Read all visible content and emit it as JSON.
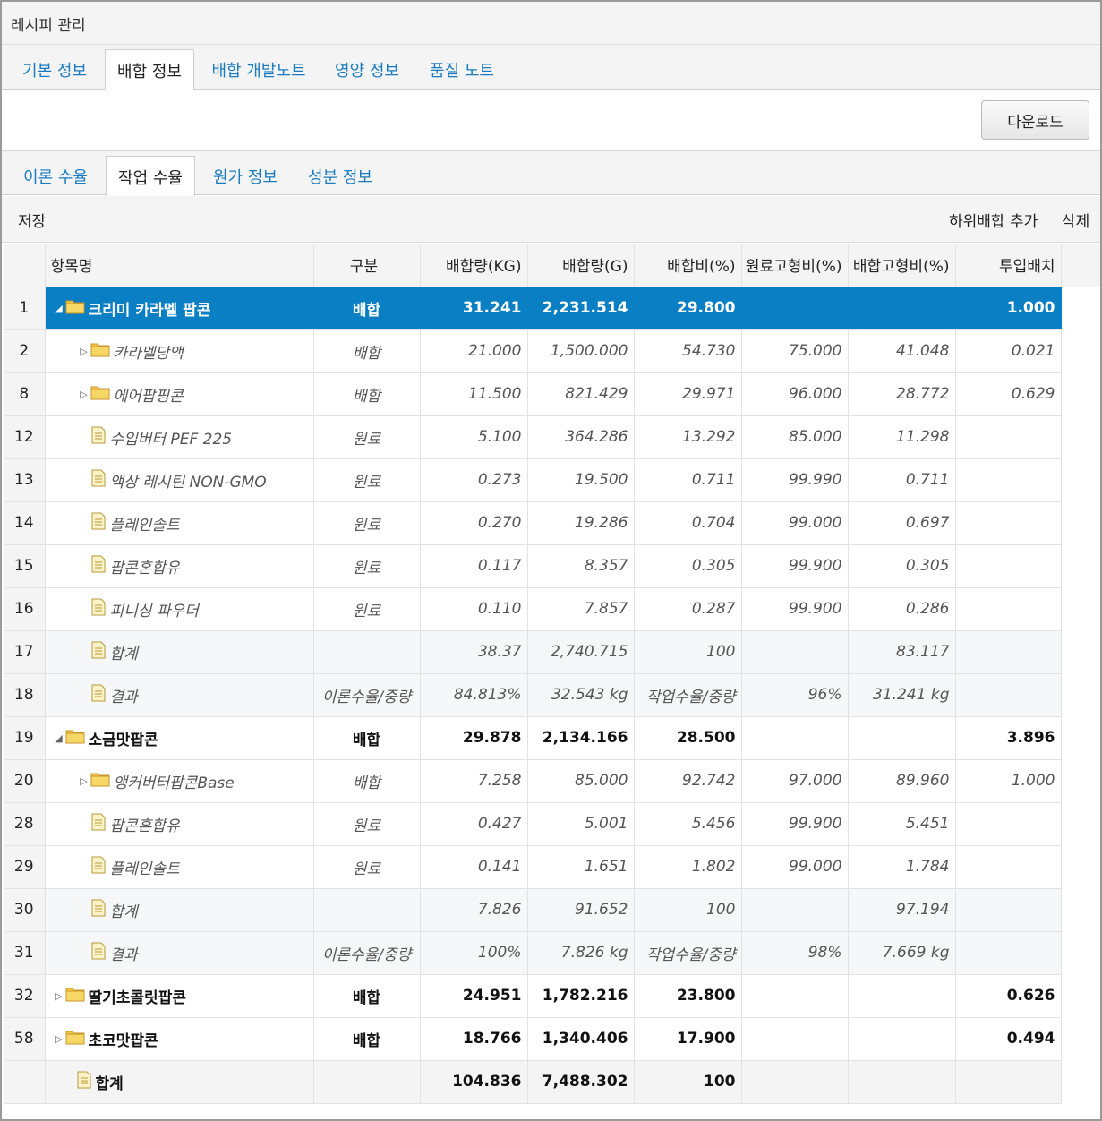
{
  "window": {
    "title": "레시피 관리"
  },
  "main_tabs": [
    {
      "label": "기본 정보",
      "active": false
    },
    {
      "label": "배합 정보",
      "active": true
    },
    {
      "label": "배합 개발노트",
      "active": false
    },
    {
      "label": "영양 정보",
      "active": false
    },
    {
      "label": "품질 노트",
      "active": false
    }
  ],
  "download_label": "다운로드",
  "sub_tabs": [
    {
      "label": "이론 수율",
      "active": false
    },
    {
      "label": "작업 수율",
      "active": true
    },
    {
      "label": "원가 정보",
      "active": false
    },
    {
      "label": "성분 정보",
      "active": false
    }
  ],
  "toolbar": {
    "save": "저장",
    "add_sub": "하위배합 추가",
    "delete": "삭제"
  },
  "columns": [
    "항목명",
    "구분",
    "배합량(KG)",
    "배합량(G)",
    "배합비(%)",
    "원료고형비(%)",
    "배합고형비(%)",
    "투입배치"
  ],
  "rows": [
    {
      "idx": "1",
      "name": "크리미 카라멜 팝콘",
      "type": "배합",
      "kg": "31.241",
      "g": "2,231.514",
      "ratio": "29.800",
      "raw_solid": "",
      "mix_solid": "",
      "batch": "1.000",
      "level": 0,
      "icon": "folder",
      "toggle": "expanded",
      "style": "bold sel"
    },
    {
      "idx": "2",
      "name": "카라멜당액",
      "type": "배합",
      "kg": "21.000",
      "g": "1,500.000",
      "ratio": "54.730",
      "raw_solid": "75.000",
      "mix_solid": "41.048",
      "batch": "0.021",
      "level": 1,
      "icon": "folder",
      "toggle": "collapsed",
      "style": "it"
    },
    {
      "idx": "8",
      "name": "에어팝핑콘",
      "type": "배합",
      "kg": "11.500",
      "g": "821.429",
      "ratio": "29.971",
      "raw_solid": "96.000",
      "mix_solid": "28.772",
      "batch": "0.629",
      "level": 1,
      "icon": "folder",
      "toggle": "collapsed",
      "style": "it"
    },
    {
      "idx": "12",
      "name": "수입버터 PEF 225",
      "type": "원료",
      "kg": "5.100",
      "g": "364.286",
      "ratio": "13.292",
      "raw_solid": "85.000",
      "mix_solid": "11.298",
      "batch": "",
      "level": 1,
      "icon": "file",
      "toggle": "none",
      "style": "it"
    },
    {
      "idx": "13",
      "name": "액상 레시틴 NON-GMO",
      "type": "원료",
      "kg": "0.273",
      "g": "19.500",
      "ratio": "0.711",
      "raw_solid": "99.990",
      "mix_solid": "0.711",
      "batch": "",
      "level": 1,
      "icon": "file",
      "toggle": "none",
      "style": "it"
    },
    {
      "idx": "14",
      "name": "플레인솔트",
      "type": "원료",
      "kg": "0.270",
      "g": "19.286",
      "ratio": "0.704",
      "raw_solid": "99.000",
      "mix_solid": "0.697",
      "batch": "",
      "level": 1,
      "icon": "file",
      "toggle": "none",
      "style": "it"
    },
    {
      "idx": "15",
      "name": "팝콘혼합유",
      "type": "원료",
      "kg": "0.117",
      "g": "8.357",
      "ratio": "0.305",
      "raw_solid": "99.900",
      "mix_solid": "0.305",
      "batch": "",
      "level": 1,
      "icon": "file",
      "toggle": "none",
      "style": "it"
    },
    {
      "idx": "16",
      "name": "피니싱 파우더",
      "type": "원료",
      "kg": "0.110",
      "g": "7.857",
      "ratio": "0.287",
      "raw_solid": "99.900",
      "mix_solid": "0.286",
      "batch": "",
      "level": 1,
      "icon": "file",
      "toggle": "none",
      "style": "it"
    },
    {
      "idx": "17",
      "name": "합계",
      "type": "",
      "kg": "38.37",
      "g": "2,740.715",
      "ratio": "100",
      "raw_solid": "",
      "mix_solid": "83.117",
      "batch": "",
      "level": 1,
      "icon": "file",
      "toggle": "none",
      "style": "it sub"
    },
    {
      "idx": "18",
      "name": "결과",
      "type": "이론수율/중량",
      "kg": "84.813%",
      "g": "32.543 kg",
      "ratio": "작업수율/중량",
      "raw_solid": "96%",
      "mix_solid": "31.241 kg",
      "batch": "",
      "level": 1,
      "icon": "file",
      "toggle": "none",
      "style": "it sub"
    },
    {
      "idx": "19",
      "name": "소금맛팝콘",
      "type": "배합",
      "kg": "29.878",
      "g": "2,134.166",
      "ratio": "28.500",
      "raw_solid": "",
      "mix_solid": "",
      "batch": "3.896",
      "level": 0,
      "icon": "folder",
      "toggle": "expanded",
      "style": "bold"
    },
    {
      "idx": "20",
      "name": "앵커버터팝콘Base",
      "type": "배합",
      "kg": "7.258",
      "g": "85.000",
      "ratio": "92.742",
      "raw_solid": "97.000",
      "mix_solid": "89.960",
      "batch": "1.000",
      "level": 1,
      "icon": "folder",
      "toggle": "collapsed",
      "style": "it"
    },
    {
      "idx": "28",
      "name": "팝콘혼합유",
      "type": "원료",
      "kg": "0.427",
      "g": "5.001",
      "ratio": "5.456",
      "raw_solid": "99.900",
      "mix_solid": "5.451",
      "batch": "",
      "level": 1,
      "icon": "file",
      "toggle": "none",
      "style": "it"
    },
    {
      "idx": "29",
      "name": "플레인솔트",
      "type": "원료",
      "kg": "0.141",
      "g": "1.651",
      "ratio": "1.802",
      "raw_solid": "99.000",
      "mix_solid": "1.784",
      "batch": "",
      "level": 1,
      "icon": "file",
      "toggle": "none",
      "style": "it"
    },
    {
      "idx": "30",
      "name": "합계",
      "type": "",
      "kg": "7.826",
      "g": "91.652",
      "ratio": "100",
      "raw_solid": "",
      "mix_solid": "97.194",
      "batch": "",
      "level": 1,
      "icon": "file",
      "toggle": "none",
      "style": "it sub"
    },
    {
      "idx": "31",
      "name": "결과",
      "type": "이론수율/중량",
      "kg": "100%",
      "g": "7.826 kg",
      "ratio": "작업수율/중량",
      "raw_solid": "98%",
      "mix_solid": "7.669 kg",
      "batch": "",
      "level": 1,
      "icon": "file",
      "toggle": "none",
      "style": "it sub"
    },
    {
      "idx": "32",
      "name": "딸기초콜릿팝콘",
      "type": "배합",
      "kg": "24.951",
      "g": "1,782.216",
      "ratio": "23.800",
      "raw_solid": "",
      "mix_solid": "",
      "batch": "0.626",
      "level": 0,
      "icon": "folder",
      "toggle": "collapsed",
      "style": "bold"
    },
    {
      "idx": "58",
      "name": "초코맛팝콘",
      "type": "배합",
      "kg": "18.766",
      "g": "1,340.406",
      "ratio": "17.900",
      "raw_solid": "",
      "mix_solid": "",
      "batch": "0.494",
      "level": 0,
      "icon": "folder",
      "toggle": "collapsed",
      "style": "bold"
    }
  ],
  "total": {
    "idx": "",
    "name": "합계",
    "type": "",
    "kg": "104.836",
    "g": "7,488.302",
    "ratio": "100",
    "raw_solid": "",
    "mix_solid": "",
    "batch": ""
  },
  "colors": {
    "selected_row": "#0a7fc4",
    "tab_link": "#1a7bbf",
    "folder": "#f0c040"
  }
}
